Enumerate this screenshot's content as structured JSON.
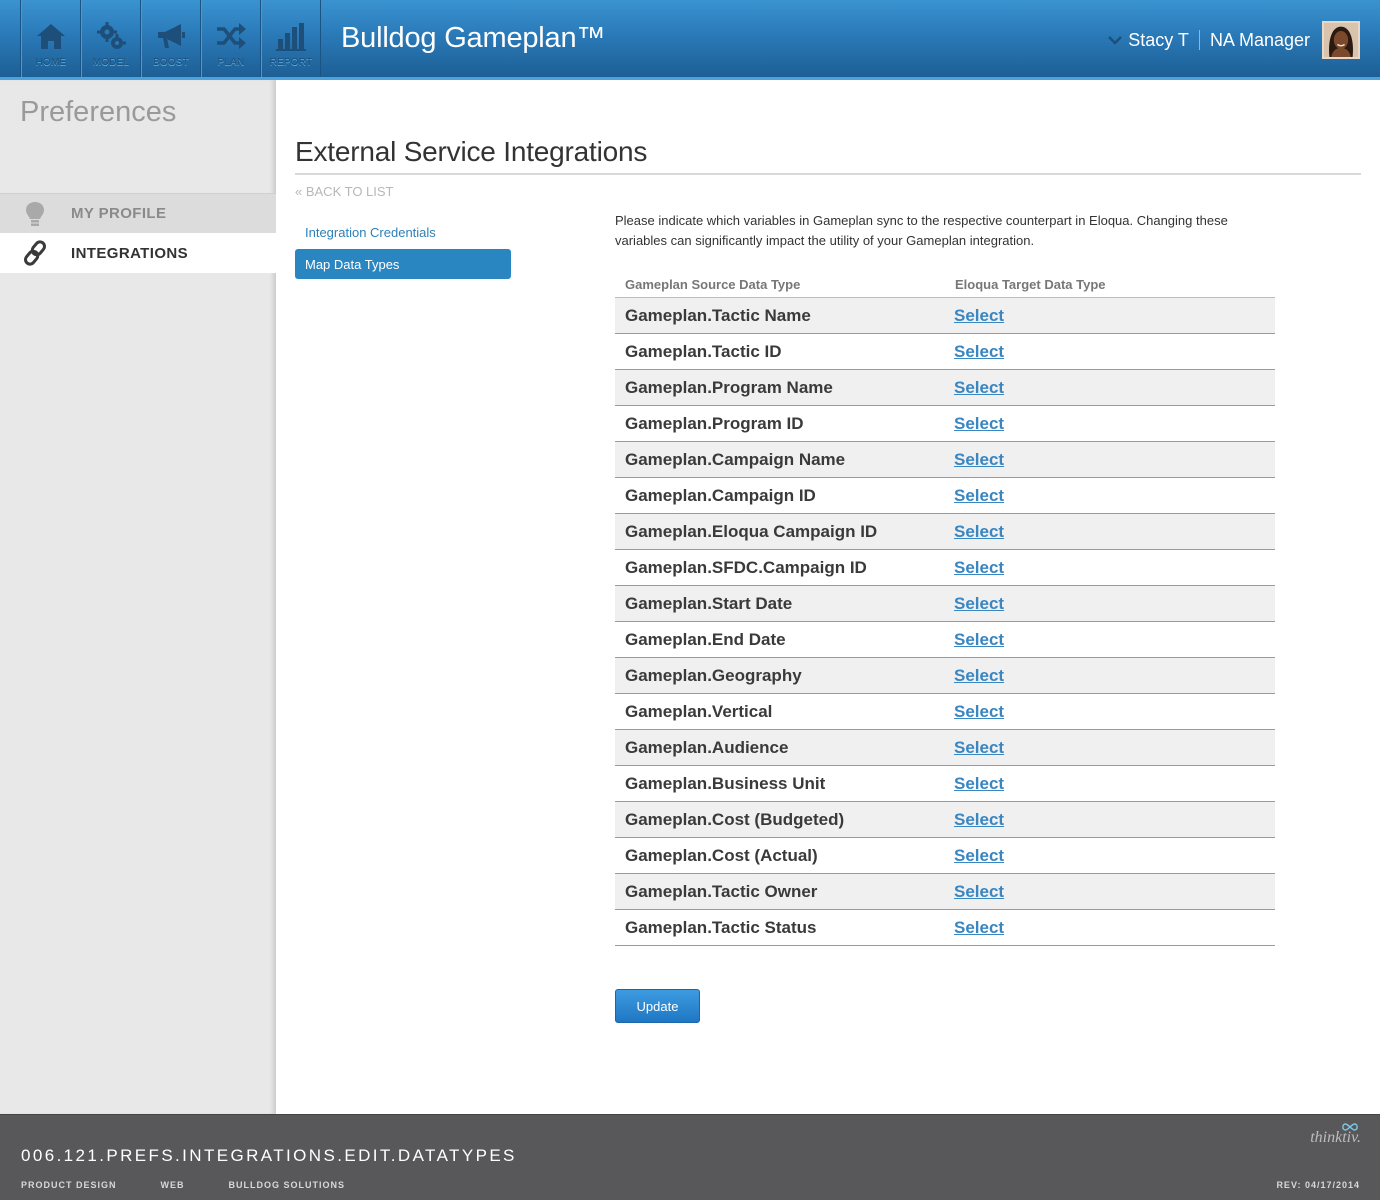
{
  "header": {
    "nav": [
      {
        "label": "HOME",
        "icon": "home-icon"
      },
      {
        "label": "MODEL",
        "icon": "gears-icon"
      },
      {
        "label": "BOOST",
        "icon": "megaphone-icon"
      },
      {
        "label": "PLAN",
        "icon": "shuffle-icon"
      },
      {
        "label": "REPORT",
        "icon": "bar-chart-icon"
      }
    ],
    "app_title": "Bulldog Gameplan™",
    "user_name": "Stacy T",
    "user_role": "NA Manager"
  },
  "sidebar": {
    "title": "Preferences",
    "items": [
      {
        "label": "MY PROFILE",
        "icon": "lightbulb-icon"
      },
      {
        "label": "INTEGRATIONS",
        "icon": "link-icon",
        "active": true
      }
    ]
  },
  "main": {
    "heading": "External Service Integrations",
    "back_link": "« BACK TO LIST",
    "subnav": [
      {
        "label": "Integration Credentials"
      },
      {
        "label": "Map Data Types",
        "active": true
      }
    ],
    "description": "Please indicate which variables in Gameplan sync to the respective counterpart in Eloqua. Changing these variables can significantly impact the utility of your Gameplan integration.",
    "table": {
      "col_source": "Gameplan Source Data Type",
      "col_target": "Eloqua Target Data Type",
      "rows": [
        {
          "source": "Gameplan.Tactic Name",
          "target": "Select"
        },
        {
          "source": "Gameplan.Tactic ID",
          "target": "Select"
        },
        {
          "source": "Gameplan.Program Name",
          "target": "Select"
        },
        {
          "source": "Gameplan.Program ID",
          "target": "Select"
        },
        {
          "source": "Gameplan.Campaign Name",
          "target": "Select"
        },
        {
          "source": "Gameplan.Campaign ID",
          "target": "Select"
        },
        {
          "source": "Gameplan.Eloqua Campaign ID",
          "target": "Select"
        },
        {
          "source": "Gameplan.SFDC.Campaign ID",
          "target": "Select"
        },
        {
          "source": "Gameplan.Start Date",
          "target": "Select"
        },
        {
          "source": "Gameplan.End Date",
          "target": "Select"
        },
        {
          "source": "Gameplan.Geography",
          "target": "Select"
        },
        {
          "source": "Gameplan.Vertical",
          "target": "Select"
        },
        {
          "source": "Gameplan.Audience",
          "target": "Select"
        },
        {
          "source": "Gameplan.Business Unit",
          "target": "Select"
        },
        {
          "source": "Gameplan.Cost (Budgeted)",
          "target": "Select"
        },
        {
          "source": "Gameplan.Cost (Actual)",
          "target": "Select"
        },
        {
          "source": "Gameplan.Tactic Owner",
          "target": "Select"
        },
        {
          "source": "Gameplan.Tactic Status",
          "target": "Select"
        }
      ]
    },
    "update_label": "Update"
  },
  "footer": {
    "screen_code": "006.121.PREFS.INTEGRATIONS.EDIT.DATATYPES",
    "meta": [
      "PRODUCT DESIGN",
      "WEB",
      "BULLDOG SOLUTIONS"
    ],
    "revision": "REV: 04/17/2014",
    "logo_text": "thinktiv."
  },
  "colors": {
    "header_blue": "#2a7ab8",
    "accent_blue": "#2a86c1",
    "link_blue": "#3a86c0",
    "footer_gray": "#58585a"
  }
}
